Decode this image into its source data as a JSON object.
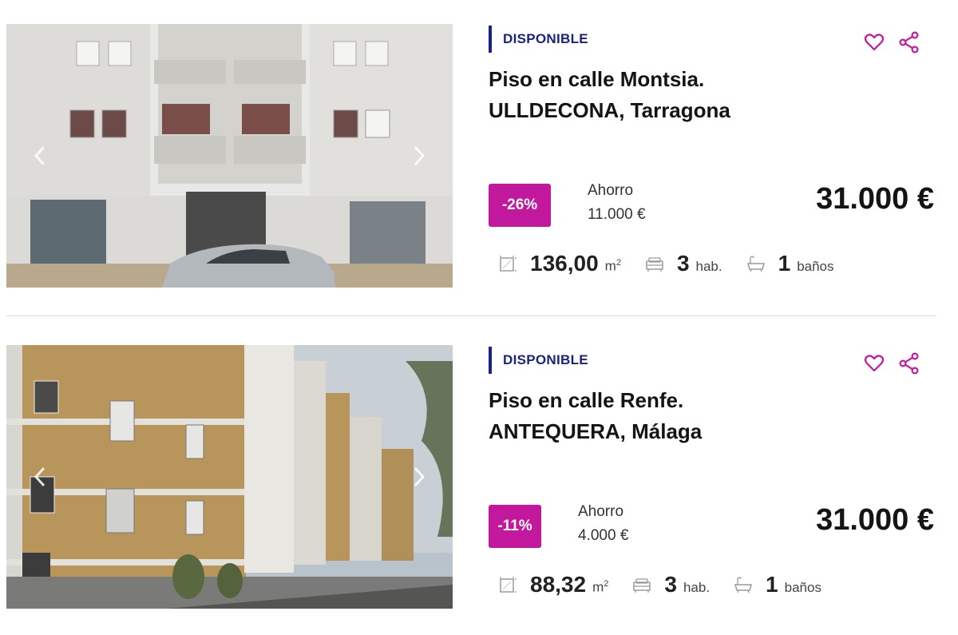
{
  "listings": [
    {
      "status": "DISPONIBLE",
      "title_line1": "Piso en calle Montsia.",
      "title_line2": "ULLDECONA, Tarragona",
      "discount": "-26%",
      "saving_label": "Ahorro",
      "saving_value": "11.000 €",
      "price": "31.000 €",
      "area": "136,00",
      "area_unit": "m",
      "area_unit_sup": "2",
      "rooms": "3",
      "rooms_unit": "hab.",
      "baths": "1",
      "baths_unit": "baños"
    },
    {
      "status": "DISPONIBLE",
      "title_line1": "Piso en calle Renfe.",
      "title_line2": "ANTEQUERA, Málaga",
      "discount": "-11%",
      "saving_label": "Ahorro",
      "saving_value": "4.000 €",
      "price": "31.000 €",
      "area": "88,32",
      "area_unit": "m",
      "area_unit_sup": "2",
      "rooms": "3",
      "rooms_unit": "hab.",
      "baths": "1",
      "baths_unit": "baños"
    }
  ],
  "colors": {
    "accent": "#c2189e",
    "status": "#1a237e"
  },
  "icons": {
    "favorite": "heart-icon",
    "share": "share-icon",
    "area": "area-icon",
    "rooms": "bed-icon",
    "baths": "bathtub-icon",
    "prev": "chevron-left-icon",
    "next": "chevron-right-icon"
  }
}
